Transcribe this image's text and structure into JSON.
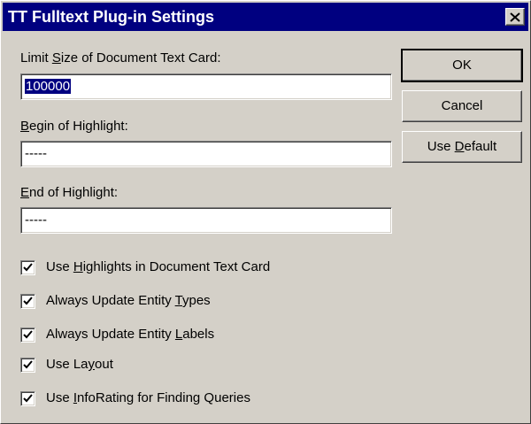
{
  "window": {
    "title": "TT Fulltext Plug-in Settings",
    "close_icon": "close-icon"
  },
  "fields": [
    {
      "label_pre": "Limit ",
      "label_key": "S",
      "label_post": "ize of Document Text Card:",
      "value": "100000",
      "selected": true
    },
    {
      "label_pre": "",
      "label_key": "B",
      "label_post": "egin of Highlight:",
      "value": "-----",
      "selected": false
    },
    {
      "label_pre": "",
      "label_key": "E",
      "label_post": "nd of Highlight:",
      "value": "-----",
      "selected": false
    }
  ],
  "buttons": {
    "ok": "OK",
    "cancel": "Cancel",
    "use_default_pre": "Use ",
    "use_default_key": "D",
    "use_default_post": "efault"
  },
  "checkboxes": [
    {
      "pre": "Use ",
      "key": "H",
      "post": "ighlights in Document Text Card",
      "checked": true
    },
    {
      "pre": "Always Update Entity ",
      "key": "T",
      "post": "ypes",
      "checked": true
    },
    {
      "pre": "Always Update Entity ",
      "key": "L",
      "post": "abels",
      "checked": true
    },
    {
      "pre": "Use La",
      "key": "y",
      "post": "out",
      "checked": true
    },
    {
      "pre": "Use ",
      "key": "I",
      "post": "nfoRating for Finding Queries",
      "checked": true
    }
  ],
  "colors": {
    "titlebar": "#000080",
    "window_bg": "#d4d0c8",
    "selection": "#000080"
  }
}
